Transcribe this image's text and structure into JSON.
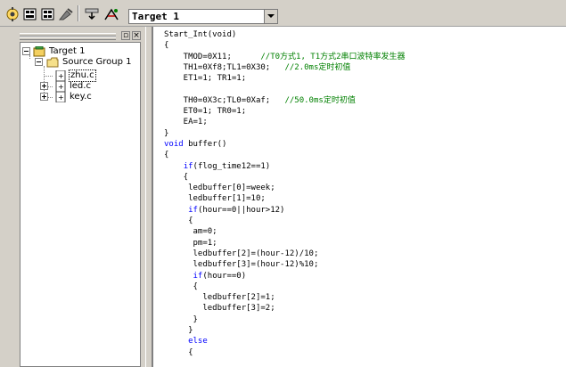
{
  "toolbar": {
    "buttons": [
      {
        "name": "options-for-target-button",
        "icon": "magic-wand-icon"
      },
      {
        "name": "build-target-button",
        "icon": "build-icon"
      },
      {
        "name": "rebuild-all-button",
        "icon": "rebuild-icon"
      },
      {
        "name": "stop-build-button",
        "icon": "stop-build-icon"
      },
      {
        "name": "download-button",
        "icon": "load-icon"
      },
      {
        "name": "options-button",
        "icon": "options-icon"
      }
    ],
    "target_select": "Target 1"
  },
  "project_tree": {
    "target": "Target 1",
    "group": "Source Group 1",
    "files": [
      "zhu.c",
      "led.c",
      "key.c"
    ]
  },
  "editor": {
    "lines": [
      [
        {
          "t": "Start_Int(void)"
        }
      ],
      [
        {
          "t": "{"
        }
      ],
      [
        {
          "t": "    TMOD=0X11;      "
        },
        {
          "t": "//T0方式1, T1方式2串口波特率发生器",
          "c": "cm"
        }
      ],
      [
        {
          "t": "    TH1=0Xf8;TL1=0X30;   "
        },
        {
          "t": "//2.0ms定时初值",
          "c": "cm"
        }
      ],
      [
        {
          "t": "    ET1=1; TR1=1;"
        }
      ],
      [
        {
          "t": ""
        }
      ],
      [
        {
          "t": "    TH0=0X3c;TL0=0Xaf;   "
        },
        {
          "t": "//50.0ms定时初值",
          "c": "cm"
        }
      ],
      [
        {
          "t": "    ET0=1; TR0=1;"
        }
      ],
      [
        {
          "t": "    EA=1;"
        }
      ],
      [
        {
          "t": "}"
        }
      ],
      [
        {
          "t": "void",
          "c": "kw"
        },
        {
          "t": " buffer()"
        }
      ],
      [
        {
          "t": "{"
        }
      ],
      [
        {
          "t": "    "
        },
        {
          "t": "if",
          "c": "kw"
        },
        {
          "t": "(flog_time12==1)"
        }
      ],
      [
        {
          "t": "    {"
        }
      ],
      [
        {
          "t": "     ledbuffer[0]=week;"
        }
      ],
      [
        {
          "t": "     ledbuffer[1]=10;"
        }
      ],
      [
        {
          "t": "     "
        },
        {
          "t": "if",
          "c": "kw"
        },
        {
          "t": "(hour==0||hour>12)"
        }
      ],
      [
        {
          "t": "     {"
        }
      ],
      [
        {
          "t": "      am=0;"
        }
      ],
      [
        {
          "t": "      pm=1;"
        }
      ],
      [
        {
          "t": "      ledbuffer[2]=(hour-12)/10;"
        }
      ],
      [
        {
          "t": "      ledbuffer[3]=(hour-12)%10;"
        }
      ],
      [
        {
          "t": "      "
        },
        {
          "t": "if",
          "c": "kw"
        },
        {
          "t": "(hour==0)"
        }
      ],
      [
        {
          "t": "      {"
        }
      ],
      [
        {
          "t": "        ledbuffer[2]=1;"
        }
      ],
      [
        {
          "t": "        ledbuffer[3]=2;"
        }
      ],
      [
        {
          "t": "      }"
        }
      ],
      [
        {
          "t": "     }"
        }
      ],
      [
        {
          "t": "     "
        },
        {
          "t": "else",
          "c": "kw"
        }
      ],
      [
        {
          "t": "     {"
        }
      ]
    ]
  }
}
